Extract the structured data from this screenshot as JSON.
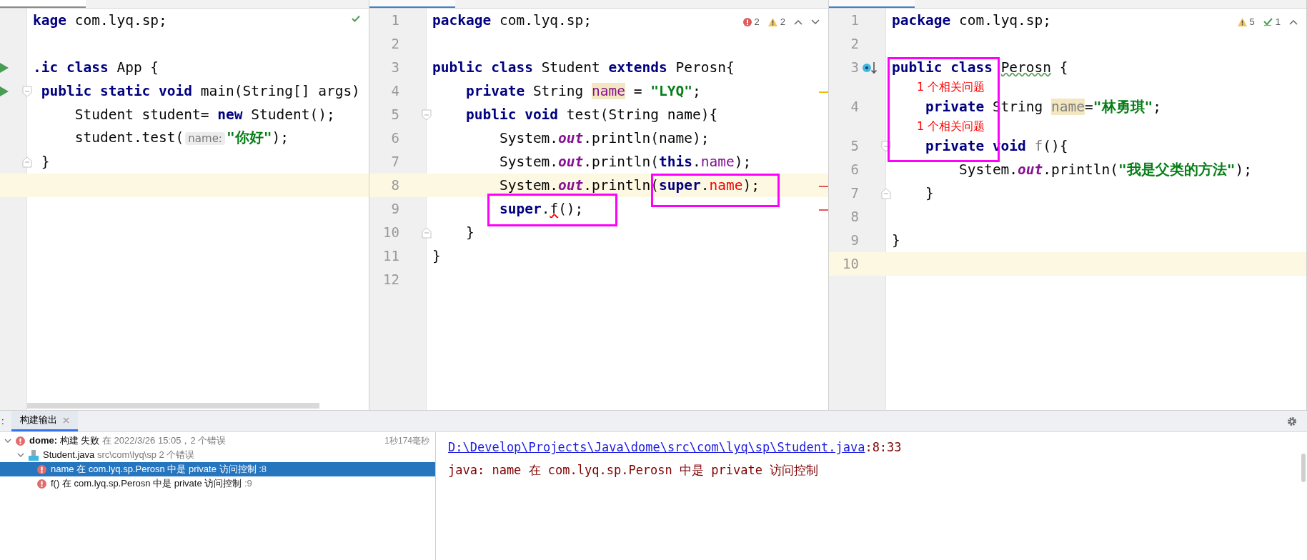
{
  "editors": [
    {
      "tab": {
        "selected": true
      },
      "indicators": [
        {
          "kind": "ok"
        }
      ],
      "lines": [
        {
          "current": false,
          "tokens": [
            {
              "kind": "keyword",
              "text": "kage"
            },
            {
              "kind": "plain",
              "text": " com.lyq.sp;"
            }
          ]
        },
        {
          "current": false
        },
        {
          "current": false,
          "gutter": {
            "kind": "run"
          },
          "tokens": [
            {
              "kind": "keyword",
              "text": ".ic class"
            },
            {
              "kind": "plain",
              "text": " App {"
            }
          ]
        },
        {
          "current": false,
          "gutter": {
            "kind": "run"
          },
          "fold": {
            "kind": "start"
          },
          "tokens": [
            {
              "kind": "keyword",
              "text": " public static void"
            },
            {
              "kind": "plain",
              "text": " main(String[] args)"
            }
          ]
        },
        {
          "current": false,
          "tokens": [
            {
              "kind": "plain",
              "text": "     Student student= "
            },
            {
              "kind": "keyword",
              "text": "new"
            },
            {
              "kind": "plain",
              "text": " Student();"
            }
          ]
        },
        {
          "current": false,
          "tokens": [
            {
              "kind": "plain",
              "text": "     student.test("
            },
            {
              "kind": "hint",
              "text": "name:"
            },
            {
              "kind": "string",
              "text": "\"你好\""
            },
            {
              "kind": "plain",
              "text": ");"
            }
          ]
        },
        {
          "current": false,
          "fold": {
            "kind": "end"
          },
          "tokens": [
            {
              "kind": "plain",
              "text": " }"
            }
          ]
        },
        {
          "current": true
        }
      ]
    },
    {
      "tab": {
        "selected": false
      },
      "indicators": [
        {
          "kind": "error",
          "count": "2"
        },
        {
          "kind": "warning",
          "count": "2"
        },
        {
          "kind": "up"
        },
        {
          "kind": "down"
        }
      ],
      "lines": [
        {
          "number": "1",
          "current": false,
          "tokens": [
            {
              "kind": "keyword",
              "text": "package"
            },
            {
              "kind": "plain",
              "text": " com.lyq.sp;"
            }
          ]
        },
        {
          "number": "2",
          "current": false
        },
        {
          "number": "3",
          "current": false,
          "tokens": [
            {
              "kind": "keyword",
              "text": "public class"
            },
            {
              "kind": "plain",
              "text": " Student "
            },
            {
              "kind": "keyword",
              "text": "extends"
            },
            {
              "kind": "plain",
              "text": " Perosn{"
            }
          ]
        },
        {
          "number": "4",
          "current": false,
          "marker": {
            "kind": "warning"
          },
          "tokens": [
            {
              "kind": "keyword",
              "text": "    private"
            },
            {
              "kind": "plain",
              "text": " String "
            },
            {
              "kind": "usage",
              "text": "name"
            },
            {
              "kind": "plain",
              "text": " = "
            },
            {
              "kind": "string",
              "text": "\"LYQ\""
            },
            {
              "kind": "plain",
              "text": ";"
            }
          ]
        },
        {
          "number": "5",
          "current": false,
          "fold": {
            "kind": "start"
          },
          "tokens": [
            {
              "kind": "keyword",
              "text": "    public void"
            },
            {
              "kind": "plain",
              "text": " test(String name){"
            }
          ]
        },
        {
          "number": "6",
          "current": false,
          "tokens": [
            {
              "kind": "plain",
              "text": "        System."
            },
            {
              "kind": "static",
              "text": "out"
            },
            {
              "kind": "plain",
              "text": ".println(name);"
            }
          ]
        },
        {
          "number": "7",
          "current": false,
          "tokens": [
            {
              "kind": "plain",
              "text": "        System."
            },
            {
              "kind": "static",
              "text": "out"
            },
            {
              "kind": "plain",
              "text": ".println("
            },
            {
              "kind": "keyword",
              "text": "this"
            },
            {
              "kind": "plain",
              "text": "."
            },
            {
              "kind": "field",
              "text": "name"
            },
            {
              "kind": "plain",
              "text": ");"
            }
          ]
        },
        {
          "number": "8",
          "current": true,
          "marker": {
            "kind": "error"
          },
          "tokens": [
            {
              "kind": "plain",
              "text": "        System."
            },
            {
              "kind": "static",
              "text": "out"
            },
            {
              "kind": "plain",
              "text": ".println("
            },
            {
              "kind": "keyword",
              "text": "super"
            },
            {
              "kind": "plain",
              "text": "."
            },
            {
              "kind": "error-field",
              "text": "name"
            },
            {
              "kind": "plain",
              "text": ");"
            }
          ]
        },
        {
          "number": "9",
          "current": false,
          "marker": {
            "kind": "error"
          },
          "tokens": [
            {
              "kind": "keyword",
              "text": "        super"
            },
            {
              "kind": "plain",
              "text": "."
            },
            {
              "kind": "error-call",
              "text": "f"
            },
            {
              "kind": "plain",
              "text": "();"
            }
          ]
        },
        {
          "number": "10",
          "current": false,
          "fold": {
            "kind": "end"
          },
          "tokens": [
            {
              "kind": "plain",
              "text": "    }"
            }
          ]
        },
        {
          "number": "11",
          "current": false,
          "tokens": [
            {
              "kind": "plain",
              "text": "}"
            }
          ]
        },
        {
          "number": "12",
          "current": false
        }
      ]
    },
    {
      "tab": {
        "selected": false
      },
      "indicators": [
        {
          "kind": "warning",
          "count": "5"
        },
        {
          "kind": "typo",
          "count": "1"
        },
        {
          "kind": "up"
        }
      ],
      "lines": [
        {
          "number": "1",
          "current": false,
          "tokens": [
            {
              "kind": "keyword",
              "text": "package"
            },
            {
              "kind": "plain",
              "text": " com.lyq.sp;"
            }
          ]
        },
        {
          "number": "2",
          "current": false
        },
        {
          "number": "3",
          "current": false,
          "gutter": {
            "kind": "override"
          },
          "tokens": [
            {
              "kind": "keyword",
              "text": "public class "
            },
            {
              "kind": "typo",
              "text": "Perosn"
            },
            {
              "kind": "plain",
              "text": " {"
            }
          ]
        },
        {
          "number": "4",
          "current": false,
          "hint_above": "1 个相关问题",
          "tokens": [
            {
              "kind": "keyword",
              "text": "    private"
            },
            {
              "kind": "plain",
              "text": " String "
            },
            {
              "kind": "usage-unused",
              "text": "name"
            },
            {
              "kind": "plain",
              "text": "="
            },
            {
              "kind": "string",
              "text": "\"林勇琪\""
            },
            {
              "kind": "plain",
              "text": ";"
            }
          ]
        },
        {
          "number": "5",
          "current": false,
          "fold": {
            "kind": "start"
          },
          "hint_above": "1 个相关问题",
          "tokens": [
            {
              "kind": "keyword",
              "text": "    private void "
            },
            {
              "kind": "unused",
              "text": "f"
            },
            {
              "kind": "plain",
              "text": "(){"
            }
          ]
        },
        {
          "number": "6",
          "current": false,
          "tokens": [
            {
              "kind": "plain",
              "text": "        System."
            },
            {
              "kind": "static",
              "text": "out"
            },
            {
              "kind": "plain",
              "text": ".println("
            },
            {
              "kind": "string",
              "text": "\"我是父类的方法\""
            },
            {
              "kind": "plain",
              "text": ");"
            }
          ]
        },
        {
          "number": "7",
          "current": false,
          "fold": {
            "kind": "end"
          },
          "tokens": [
            {
              "kind": "plain",
              "text": "    }"
            }
          ]
        },
        {
          "number": "8",
          "current": false
        },
        {
          "number": "9",
          "current": false,
          "tokens": [
            {
              "kind": "plain",
              "text": "}"
            }
          ]
        },
        {
          "number": "10",
          "current": true
        }
      ]
    }
  ],
  "build_panel": {
    "edge_text": ":",
    "tabs": [
      {
        "label": "构建输出",
        "selected": true
      }
    ],
    "tree": [
      {
        "kind": "build",
        "title": "dome:",
        "text": " 构建 失败",
        "detail": " 在 2022/3/26 15:05，2 个错误",
        "time": "1秒174毫秒",
        "expanded": true,
        "selected": false,
        "children": [
          {
            "kind": "file",
            "text": "Student.java",
            "detail": " src\\com\\lyq\\sp 2 个错误",
            "expanded": true,
            "selected": false,
            "children": [
              {
                "kind": "error",
                "text": "name 在 com.lyq.sp.Perosn 中是 private 访问控制",
                "detail": " :8",
                "selected": true
              },
              {
                "kind": "error",
                "text": "f() 在 com.lyq.sp.Perosn 中是 private 访问控制",
                "detail": " :9",
                "selected": false
              }
            ]
          }
        ]
      }
    ],
    "console": [
      {
        "kind": "link",
        "text": "D:\\Develop\\Projects\\Java\\dome\\src\\com\\lyq\\sp\\Student.java",
        "suffix": ":8:33"
      },
      {
        "kind": "message",
        "text": "java: name 在 com.lyq.sp.Perosn 中是 private 访问控制"
      }
    ]
  }
}
